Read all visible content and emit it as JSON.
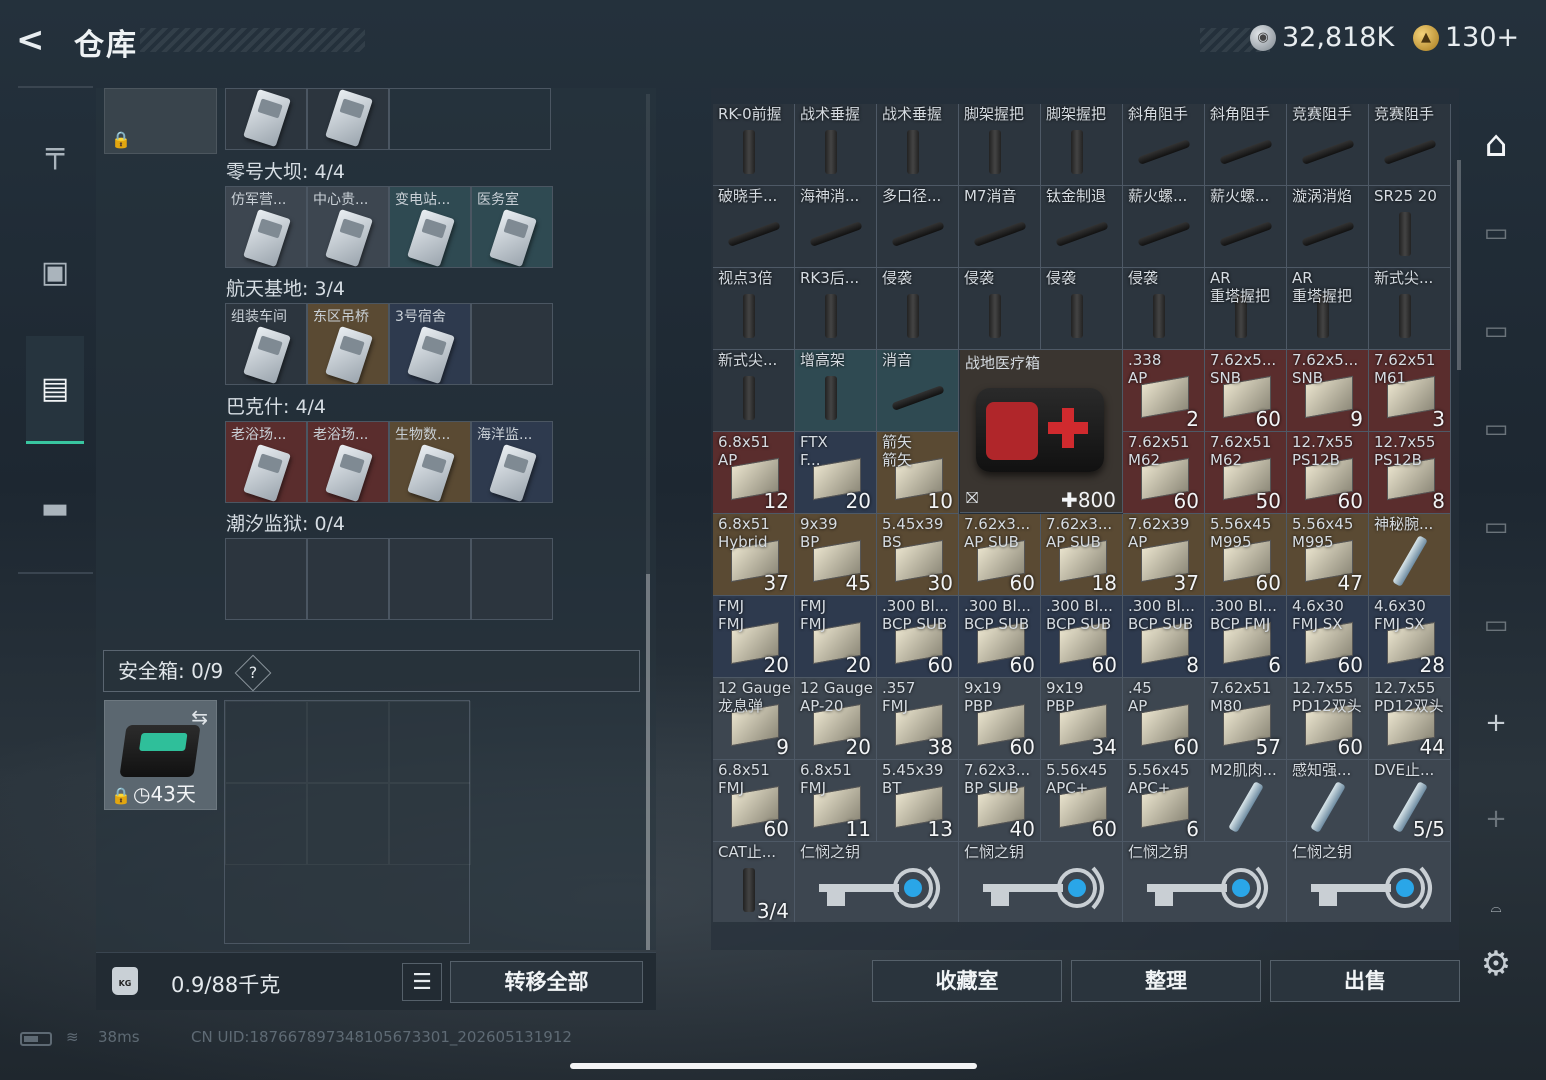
{
  "header": {
    "title": "仓库",
    "currency_silver": "32,818K",
    "currency_gold": "130+"
  },
  "sidenav": {
    "items": [
      "gun",
      "backpack",
      "vest",
      "toolbox"
    ]
  },
  "left": {
    "sections": [
      {
        "title": "零号大坝: 4/4",
        "cells": [
          "仿军营...",
          "中心贵...",
          "变电站...",
          "医务室"
        ]
      },
      {
        "title": "航天基地: 3/4",
        "cells": [
          "组装车间",
          "东区吊桥",
          "3号宿舍",
          ""
        ]
      },
      {
        "title": "巴克什: 4/4",
        "cells": [
          "老浴场...",
          "老浴场...",
          "生物数...",
          "海洋监..."
        ]
      },
      {
        "title": "潮汐监狱: 0/4",
        "cells": [
          "",
          "",
          "",
          ""
        ]
      }
    ],
    "safebox_label": "安全箱:  0/9",
    "safebox_help": "?",
    "safebox_days": "43天",
    "weight": "0.9/88千克",
    "transfer_label": "转移全部"
  },
  "stash": {
    "rows": [
      [
        {
          "n": "RK-0前握",
          "q": "",
          "t": "gun"
        },
        {
          "n": "战术垂握",
          "q": "",
          "t": "gun"
        },
        {
          "n": "战术垂握",
          "q": "",
          "t": "gun"
        },
        {
          "n": "脚架握把",
          "q": "",
          "t": "gun"
        },
        {
          "n": "脚架握把",
          "q": "",
          "t": "gun"
        },
        {
          "n": "斜角阻手",
          "q": "",
          "t": "barrel"
        },
        {
          "n": "斜角阻手",
          "q": "",
          "t": "barrel"
        },
        {
          "n": "竞赛阻手",
          "q": "",
          "t": "barrel"
        },
        {
          "n": "竞赛阻手",
          "q": "",
          "t": "barrel"
        }
      ],
      [
        {
          "n": "破晓手...",
          "q": "",
          "t": "barrel"
        },
        {
          "n": "海神消...",
          "q": "",
          "t": "barrel"
        },
        {
          "n": "多口径...",
          "q": "",
          "t": "barrel"
        },
        {
          "n": "M7消音",
          "q": "",
          "t": "barrel"
        },
        {
          "n": "钛金制退",
          "q": "",
          "t": "barrel"
        },
        {
          "n": "薪火螺...",
          "q": "",
          "t": "barrel"
        },
        {
          "n": "薪火螺...",
          "q": "",
          "t": "barrel"
        },
        {
          "n": "漩涡消焰",
          "q": "",
          "t": "barrel"
        },
        {
          "n": "SR25 20",
          "q": "",
          "t": "gun"
        }
      ],
      [
        {
          "n": "视点3倍",
          "q": "",
          "t": "gun"
        },
        {
          "n": "RK3后...",
          "q": "",
          "t": "gun"
        },
        {
          "n": "侵袭",
          "q": "",
          "t": "gun"
        },
        {
          "n": "侵袭",
          "q": "",
          "t": "gun"
        },
        {
          "n": "侵袭",
          "q": "",
          "t": "gun"
        },
        {
          "n": "侵袭",
          "q": "",
          "t": "gun"
        },
        {
          "n": "AR\n重塔握把",
          "q": "",
          "t": "gun"
        },
        {
          "n": "AR\n重塔握把",
          "q": "",
          "t": "gun"
        },
        {
          "n": "新式尖...",
          "q": "",
          "t": "gun"
        }
      ],
      [
        {
          "n": "新式尖...",
          "q": "",
          "t": "gun"
        },
        {
          "n": "增高架",
          "q": "",
          "t": "gun",
          "bg": "teal"
        },
        {
          "n": "消音",
          "q": "",
          "t": "barrel",
          "bg": "teal"
        },
        {
          "n": "",
          "q": "",
          "t": "skip"
        },
        {
          "n": "",
          "q": "",
          "t": "skip"
        },
        {
          "n": ".338\nAP",
          "q": "2",
          "t": "ammo",
          "bg": "red"
        },
        {
          "n": "7.62x5...\nSNB",
          "q": "60",
          "t": "ammo",
          "bg": "red"
        },
        {
          "n": "7.62x5...\nSNB",
          "q": "9",
          "t": "ammo",
          "bg": "red"
        },
        {
          "n": "7.62x51\nM61",
          "q": "3",
          "t": "ammo",
          "bg": "red"
        }
      ],
      [
        {
          "n": "6.8x51\nAP",
          "q": "12",
          "t": "ammo",
          "bg": "red"
        },
        {
          "n": "FTX\nF...",
          "q": "20",
          "t": "ammo",
          "bg": "blue"
        },
        {
          "n": "箭矢\n箭矢",
          "q": "10",
          "t": "ammo",
          "bg": "tan"
        },
        {
          "n": "",
          "q": "",
          "t": "skip"
        },
        {
          "n": "",
          "q": "",
          "t": "skip"
        },
        {
          "n": "7.62x51\nM62",
          "q": "60",
          "t": "ammo",
          "bg": "red"
        },
        {
          "n": "7.62x51\nM62",
          "q": "50",
          "t": "ammo",
          "bg": "red"
        },
        {
          "n": "12.7x55\nPS12B",
          "q": "60",
          "t": "ammo",
          "bg": "red"
        },
        {
          "n": "12.7x55\nPS12B",
          "q": "8",
          "t": "ammo",
          "bg": "red"
        }
      ],
      [
        {
          "n": "6.8x51\nHybrid",
          "q": "37",
          "t": "ammo",
          "bg": "tan"
        },
        {
          "n": "9x39\nBP",
          "q": "45",
          "t": "ammo",
          "bg": "tan"
        },
        {
          "n": "5.45x39\nBS",
          "q": "30",
          "t": "ammo",
          "bg": "tan"
        },
        {
          "n": "7.62x3...\nAP SUB",
          "q": "60",
          "t": "ammo",
          "bg": "tan"
        },
        {
          "n": "7.62x3...\nAP SUB",
          "q": "18",
          "t": "ammo",
          "bg": "tan"
        },
        {
          "n": "7.62x39\nAP",
          "q": "37",
          "t": "ammo",
          "bg": "tan"
        },
        {
          "n": "5.56x45\nM995",
          "q": "60",
          "t": "ammo",
          "bg": "tan"
        },
        {
          "n": "5.56x45\nM995",
          "q": "47",
          "t": "ammo",
          "bg": "tan"
        },
        {
          "n": "神秘腕...",
          "q": "",
          "t": "syr",
          "bg": "tan"
        }
      ],
      [
        {
          "n": "FMJ\nFMJ",
          "q": "20",
          "t": "ammo",
          "bg": "blue"
        },
        {
          "n": "FMJ\nFMJ",
          "q": "20",
          "t": "ammo",
          "bg": "blue"
        },
        {
          "n": ".300 Bl...\nBCP SUB",
          "q": "60",
          "t": "ammo",
          "bg": "blue"
        },
        {
          "n": ".300 Bl...\nBCP SUB",
          "q": "60",
          "t": "ammo",
          "bg": "blue"
        },
        {
          "n": ".300 Bl...\nBCP SUB",
          "q": "60",
          "t": "ammo",
          "bg": "blue"
        },
        {
          "n": ".300 Bl...\nBCP SUB",
          "q": "8",
          "t": "ammo",
          "bg": "blue"
        },
        {
          "n": ".300 Bl...\nBCP FMJ",
          "q": "6",
          "t": "ammo",
          "bg": "blue"
        },
        {
          "n": "4.6x30\nFMJ SX",
          "q": "60",
          "t": "ammo",
          "bg": "blue"
        },
        {
          "n": "4.6x30\nFMJ SX",
          "q": "28",
          "t": "ammo",
          "bg": "blue"
        }
      ],
      [
        {
          "n": "12 Gauge\n龙息弹",
          "q": "9",
          "t": "ammo",
          "bg": "grey"
        },
        {
          "n": "12 Gauge\nAP-20",
          "q": "20",
          "t": "ammo",
          "bg": "grey"
        },
        {
          "n": ".357\nFMJ",
          "q": "38",
          "t": "ammo",
          "bg": "grey"
        },
        {
          "n": "9x19\nPBP",
          "q": "60",
          "t": "ammo",
          "bg": "grey"
        },
        {
          "n": "9x19\nPBP",
          "q": "34",
          "t": "ammo",
          "bg": "grey"
        },
        {
          "n": ".45\nAP",
          "q": "60",
          "t": "ammo",
          "bg": "grey"
        },
        {
          "n": "7.62x51\nM80",
          "q": "57",
          "t": "ammo",
          "bg": "grey"
        },
        {
          "n": "12.7x55\nPD12双头",
          "q": "60",
          "t": "ammo",
          "bg": "grey"
        },
        {
          "n": "12.7x55\nPD12双头",
          "q": "44",
          "t": "ammo",
          "bg": "grey"
        }
      ],
      [
        {
          "n": "6.8x51\nFMJ",
          "q": "60",
          "t": "ammo",
          "bg": "grey"
        },
        {
          "n": "6.8x51\nFMJ",
          "q": "11",
          "t": "ammo",
          "bg": "grey"
        },
        {
          "n": "5.45x39\nBT",
          "q": "13",
          "t": "ammo",
          "bg": "grey"
        },
        {
          "n": "7.62x3...\nBP SUB",
          "q": "40",
          "t": "ammo",
          "bg": "grey"
        },
        {
          "n": "5.56x45\nAPC+",
          "q": "60",
          "t": "ammo",
          "bg": "grey"
        },
        {
          "n": "5.56x45\nAPC+",
          "q": "6",
          "t": "ammo",
          "bg": "grey"
        },
        {
          "n": "M2肌肉...",
          "q": "",
          "t": "syr",
          "bg": "grey"
        },
        {
          "n": "感知强...",
          "q": "",
          "t": "syr",
          "bg": "grey"
        },
        {
          "n": "DVE止...",
          "q": "5/5",
          "t": "syr",
          "bg": "grey"
        }
      ],
      [
        {
          "n": "CAT止...",
          "q": "3/4",
          "t": "gun",
          "bg": "grey"
        },
        {
          "n": "仁悯之钥",
          "q": "",
          "t": "key",
          "bg": "grey"
        },
        {
          "n": "",
          "q": "",
          "t": "skip"
        },
        {
          "n": "仁悯之钥",
          "q": "",
          "t": "key",
          "bg": "grey"
        },
        {
          "n": "",
          "q": "",
          "t": "skip"
        },
        {
          "n": "仁悯之钥",
          "q": "",
          "t": "key",
          "bg": "grey"
        },
        {
          "n": "",
          "q": "",
          "t": "skip"
        },
        {
          "n": "仁悯之钥",
          "q": "",
          "t": "key",
          "bg": "grey"
        },
        {
          "n": "",
          "q": "",
          "t": "skip"
        }
      ]
    ],
    "medkit": {
      "name": "战地医疗箱",
      "durability": "800"
    }
  },
  "actions": {
    "collection": "收藏室",
    "sort": "整理",
    "sell": "出售"
  },
  "footer": {
    "ping": "38ms",
    "uid": "CN UID:187667897348105673301_202605131912"
  }
}
